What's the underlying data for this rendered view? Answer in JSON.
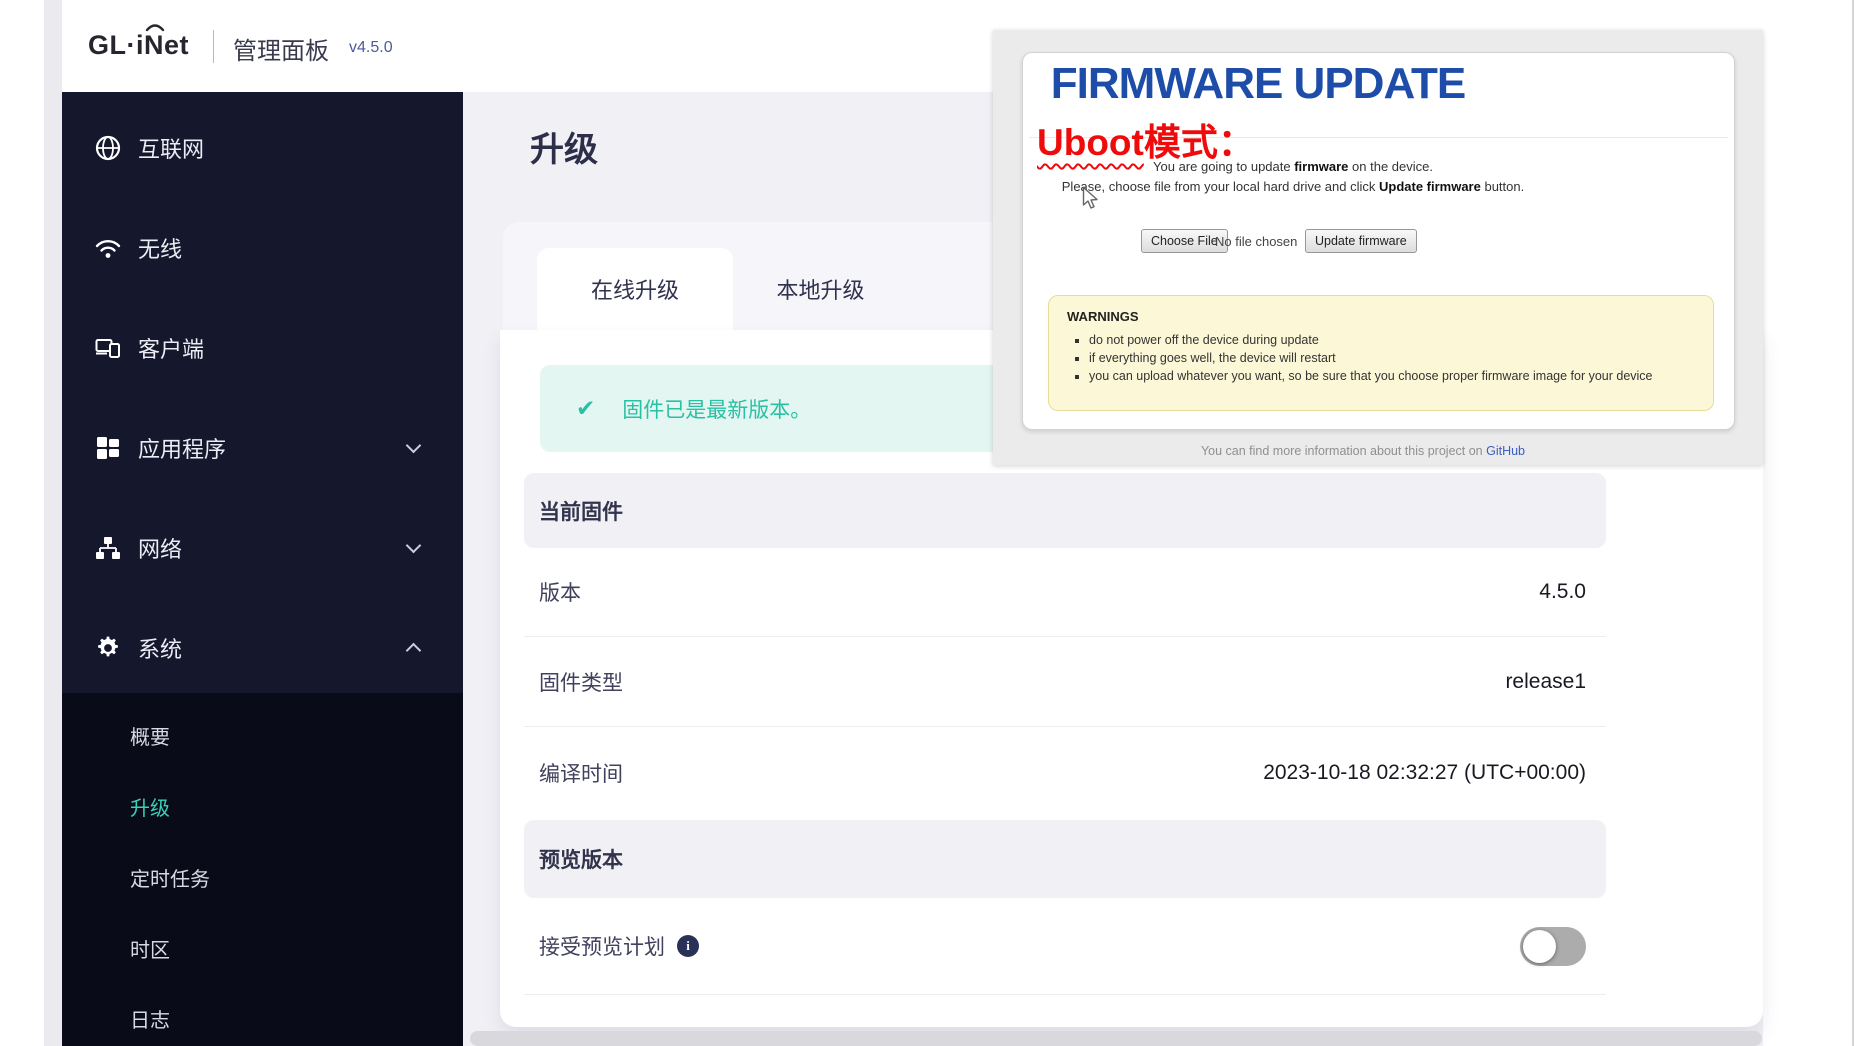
{
  "header": {
    "logo": "GL·iNet",
    "app_title": "管理面板",
    "version": "v4.5.0"
  },
  "sidebar": {
    "items": [
      {
        "label": "互联网",
        "icon": "globe-icon"
      },
      {
        "label": "无线",
        "icon": "wifi-icon"
      },
      {
        "label": "客户端",
        "icon": "devices-icon"
      },
      {
        "label": "应用程序",
        "icon": "apps-grid-icon",
        "chevron": "down"
      },
      {
        "label": "网络",
        "icon": "network-tree-icon",
        "chevron": "down"
      },
      {
        "label": "系统",
        "icon": "gear-icon",
        "chevron": "up"
      }
    ],
    "submenu": [
      {
        "label": "概要",
        "active": false
      },
      {
        "label": "升级",
        "active": true
      },
      {
        "label": "定时任务",
        "active": false
      },
      {
        "label": "时区",
        "active": false
      },
      {
        "label": "日志",
        "active": false
      }
    ]
  },
  "page": {
    "title": "升级",
    "tabs": [
      {
        "label": "在线升级",
        "active": true
      },
      {
        "label": "本地升级",
        "active": false
      }
    ],
    "alert": {
      "check": "✔",
      "text": "固件已是最新版本。"
    },
    "current_firmware": {
      "title": "当前固件",
      "rows": [
        {
          "label": "版本",
          "value": "4.5.0"
        },
        {
          "label": "固件类型",
          "value": "release1"
        },
        {
          "label": "编译时间",
          "value": "2023-10-18 02:32:27 (UTC+00:00)"
        }
      ]
    },
    "preview": {
      "title": "预览版本",
      "row_label": "接受预览计划",
      "info_icon": "i",
      "toggle_state": "off"
    }
  },
  "overlay": {
    "title": "FIRMWARE UPDATE",
    "annotation": {
      "underlined": "Uboot",
      "rest": "模式："
    },
    "line1": [
      "You are going to update ",
      "firmware",
      " on the device."
    ],
    "line2": [
      "Please, choose file from your local hard drive and click ",
      "Update firmware",
      " button."
    ],
    "choose_file_button": "Choose File",
    "file_status": "No file chosen",
    "update_button": "Update firmware",
    "warnings": {
      "title": "WARNINGS",
      "items": [
        "do not power off the device during update",
        "if everything goes well, the device will restart",
        "you can upload whatever you want, so be sure that you choose proper firmware image for your device"
      ]
    },
    "footer": {
      "text": "You can find more information about this project on ",
      "link": "GitHub"
    }
  },
  "colors": {
    "sidebar_bg": "#15172d",
    "submenu_bg": "#0a0b18",
    "active_teal": "#36d3b8",
    "alert_teal": "#2bc0a4",
    "page_bg": "#f1f0f5",
    "firmware_blue": "#1d4da8",
    "annotation_red": "#ef0b0b",
    "warning_bg": "#fcf8d7"
  }
}
